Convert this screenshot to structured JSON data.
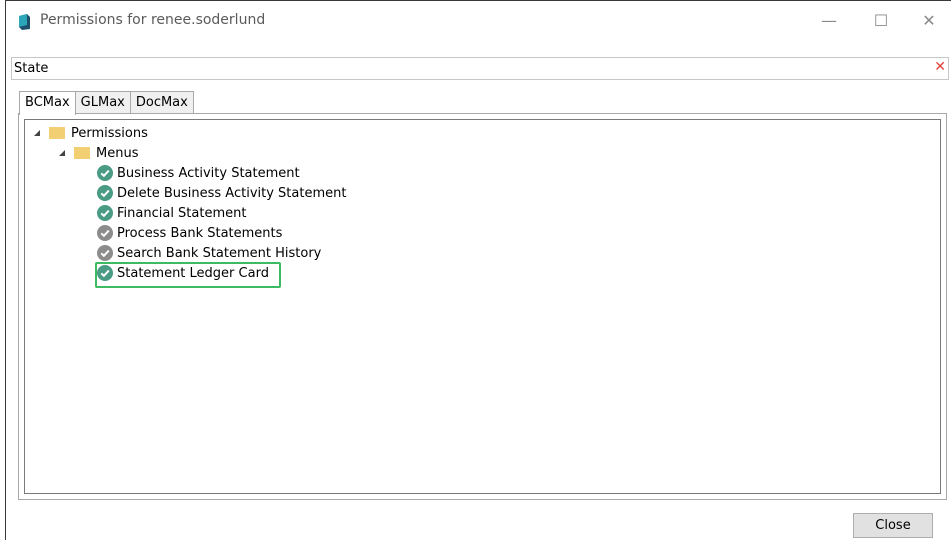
{
  "window": {
    "title": "Permissions for renee.soderlund",
    "minimize_glyph": "—",
    "maximize_glyph": "☐",
    "close_glyph": "✕"
  },
  "state": {
    "label": "State",
    "clear_glyph": "✕",
    "clear_color": "#e0443a"
  },
  "tabs": [
    {
      "label": "BCMax",
      "active": true
    },
    {
      "label": "GLMax",
      "active": false
    },
    {
      "label": "DocMax",
      "active": false
    }
  ],
  "tree": {
    "root": {
      "label": "Permissions",
      "icon": "folder-icon",
      "expanded": true
    },
    "menus": {
      "label": "Menus",
      "icon": "folder-icon",
      "expanded": true
    },
    "items": [
      {
        "label": "Business Activity Statement",
        "granted": true
      },
      {
        "label": "Delete Business Activity Statement",
        "granted": true
      },
      {
        "label": "Financial Statement",
        "granted": true
      },
      {
        "label": "Process Bank Statements",
        "granted": false
      },
      {
        "label": "Search Bank Statement History",
        "granted": false
      },
      {
        "label": "Statement Ledger Card",
        "granted": true,
        "highlighted": true
      }
    ]
  },
  "buttons": {
    "close": "Close"
  },
  "colors": {
    "granted": "#4a9b84",
    "not_granted": "#8c8c8c",
    "folder": "#f3cf74",
    "highlight": "#3dbb62"
  }
}
